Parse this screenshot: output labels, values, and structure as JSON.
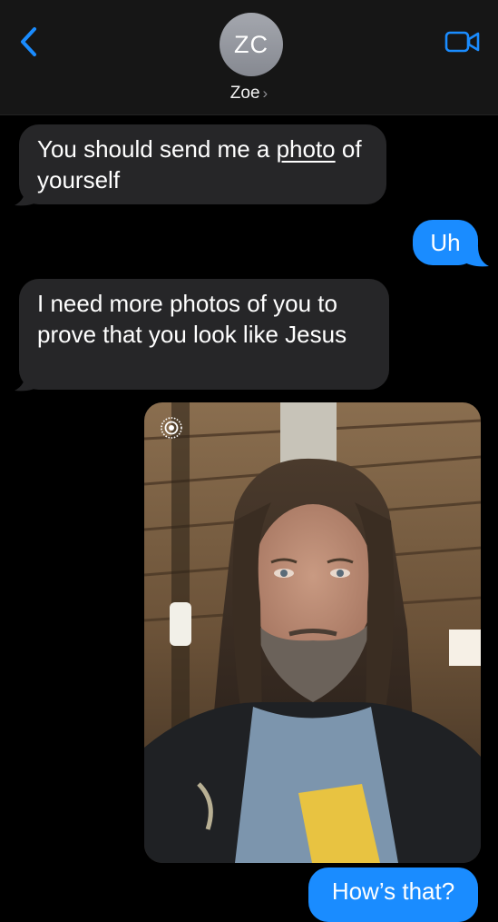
{
  "header": {
    "avatar_initials": "ZC",
    "contact_name": "Zoe",
    "chevron": "›",
    "icons": {
      "back": "chevron-left-icon",
      "video": "video-camera-icon"
    },
    "accent": "#1a8cff"
  },
  "messages": [
    {
      "side": "received",
      "text_before": "You should send me a ",
      "link": "photo",
      "text_after": " of yourself"
    },
    {
      "side": "sent",
      "text": "Uh"
    },
    {
      "side": "received",
      "text": "I need more photos of you to prove that you look like Jesus"
    },
    {
      "side": "sent",
      "type": "photo",
      "live_badge": "live-photo-icon"
    },
    {
      "side": "sent",
      "text": "How’s that?"
    }
  ],
  "colors": {
    "received_bubble": "#262628",
    "sent_bubble": "#1a8cff",
    "background": "#000000"
  }
}
